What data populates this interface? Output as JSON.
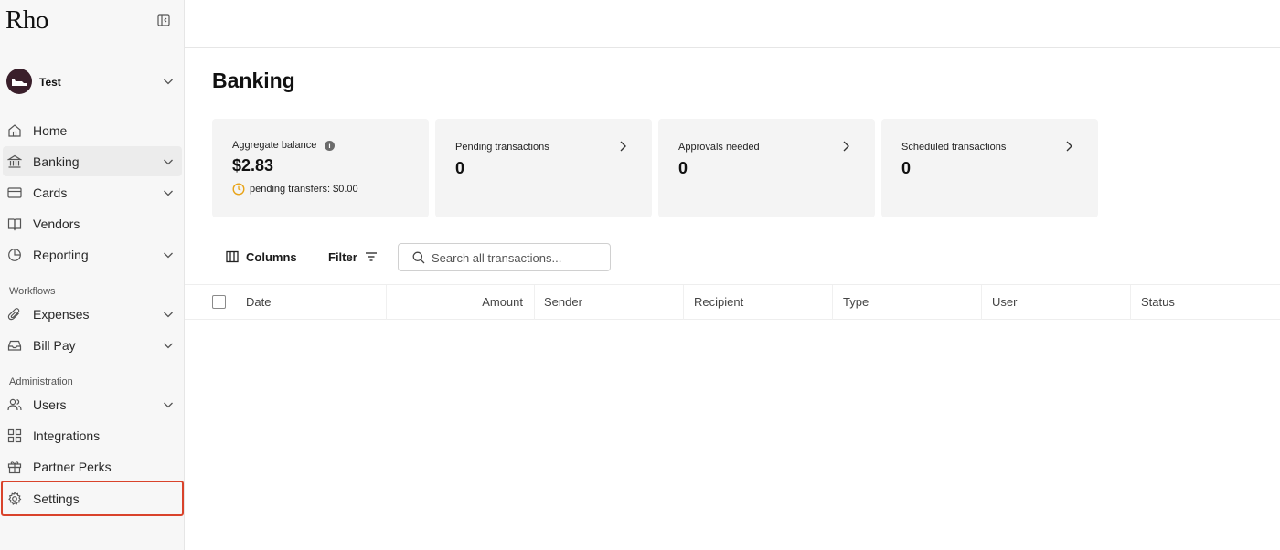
{
  "app": {
    "logo_text": "Rho"
  },
  "account": {
    "name": "Test"
  },
  "sidebar": {
    "items": [
      {
        "label": "Home",
        "icon": "home-icon"
      },
      {
        "label": "Banking",
        "icon": "bank-icon",
        "active": true,
        "expandable": true
      },
      {
        "label": "Cards",
        "icon": "card-icon",
        "expandable": true
      },
      {
        "label": "Vendors",
        "icon": "book-icon"
      },
      {
        "label": "Reporting",
        "icon": "pie-chart-icon",
        "expandable": true
      }
    ],
    "workflows_label": "Workflows",
    "workflows": [
      {
        "label": "Expenses",
        "icon": "paperclip-icon",
        "expandable": true
      },
      {
        "label": "Bill Pay",
        "icon": "inbox-icon",
        "expandable": true
      }
    ],
    "administration_label": "Administration",
    "administration": [
      {
        "label": "Users",
        "icon": "users-icon",
        "expandable": true
      },
      {
        "label": "Integrations",
        "icon": "grid-icon"
      },
      {
        "label": "Partner Perks",
        "icon": "gift-icon"
      },
      {
        "label": "Settings",
        "icon": "gear-icon",
        "highlighted": true
      }
    ]
  },
  "main": {
    "title": "Banking",
    "cards": [
      {
        "label": "Aggregate balance",
        "value": "$2.83",
        "pending_text": "pending transfers: $0.00"
      },
      {
        "label": "Pending transactions",
        "value": "0"
      },
      {
        "label": "Approvals needed",
        "value": "0"
      },
      {
        "label": "Scheduled transactions",
        "value": "0"
      }
    ],
    "toolbar": {
      "columns_label": "Columns",
      "filter_label": "Filter",
      "search_placeholder": "Search all transactions..."
    },
    "table": {
      "columns": [
        "Date",
        "Amount",
        "Sender",
        "Recipient",
        "Type",
        "User",
        "Status"
      ]
    }
  },
  "colors": {
    "highlight": "#d9432b",
    "pending_clock": "#e8a317",
    "avatar": "#3a1f2b"
  }
}
